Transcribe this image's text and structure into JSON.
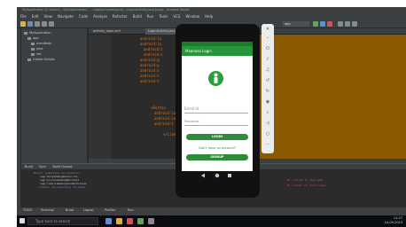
{
  "ide": {
    "title": "MyApplication [C:\\Users\\...\\MyApplication] - ...\\app\\src\\main\\java\\...\\LoginActivity.java [app] - Android Studio",
    "menu": [
      "File",
      "Edit",
      "View",
      "Navigate",
      "Code",
      "Analyze",
      "Refactor",
      "Build",
      "Run",
      "Tools",
      "VCS",
      "Window",
      "Help"
    ],
    "run_config": "app"
  },
  "project": {
    "root": "MyApplication",
    "items": [
      "app",
      "manifests",
      "java",
      "res",
      "Gradle Scripts"
    ]
  },
  "editor": {
    "tabs": [
      "activity_login.xml",
      "LoginActivity.java"
    ],
    "lines": [
      "android:la",
      "android:la",
      "android:t",
      "android:c",
      "android:g",
      "android:p",
      "android:s",
      "android:s",
      "android:t",
      "<Button",
      "android:la",
      "android:la",
      "android:t",
      "</Linea"
    ],
    "strings": [
      "#FFFFFF\"",
      "#4CAF50\" />"
    ]
  },
  "bottom": {
    "tabs": [
      "Build",
      "Sync",
      "Build Output"
    ],
    "log": [
      "Build: completed successfully",
      ":app:mergeDebugResources",
      ":app:processDebugManifest",
      ":app:compileDebugJavaWithJavac",
      "Install successfully finished"
    ],
    "warnings": [
      "W/: Failed to open APK",
      "E/: Could not find class"
    ]
  },
  "status_tabs": [
    "TODO",
    "Terminal",
    "Build",
    "Logcat",
    "Profiler",
    "Run"
  ],
  "status_message": "Install successfully finished in 3 s 245 ms. App restart successful without requiring a re-install.",
  "taskbar": {
    "search_placeholder": "Type here to search",
    "time": "11:27",
    "date": "24-09-2019"
  },
  "app": {
    "title": "Maanasa Login",
    "email_hint": "Email Id",
    "password_hint": "Password",
    "login_label": "LOGIN",
    "no_account_text": "Don't have an account?",
    "signup_label": "SIGNUP"
  },
  "colors": {
    "app_primary": "#27963b",
    "app_dark": "#1b7d2a",
    "ide_bg": "#2b2b2b"
  }
}
